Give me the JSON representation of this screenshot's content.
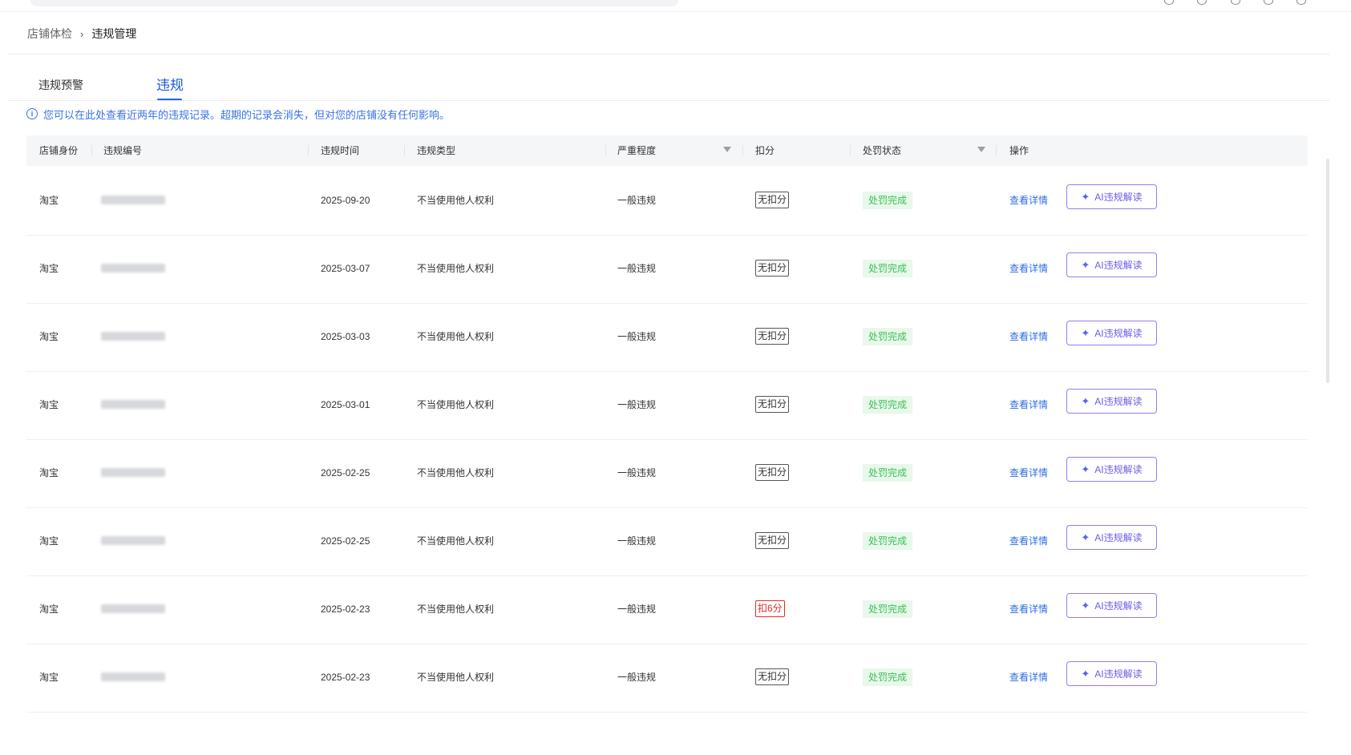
{
  "breadcrumb": {
    "parent": "店铺体检",
    "separator": "›",
    "current": "违规管理"
  },
  "tabs": [
    {
      "label": "违规预警"
    },
    {
      "label": "违规"
    }
  ],
  "notice": {
    "text": "您可以在此处查看近两年的违规记录。超期的记录会消失，但对您的店铺没有任何影响。"
  },
  "table": {
    "headers": {
      "shop_identity": "店铺身份",
      "violation_no": "违规编号",
      "violation_time": "违规时间",
      "violation_type": "违规类型",
      "severity": "严重程度",
      "deduction": "扣分",
      "penalty_status": "处罚状态",
      "actions": "操作"
    },
    "rows": [
      {
        "shop": "淘宝",
        "date": "2025-09-20",
        "type": "不当使用他人权利",
        "severity": "一般违规",
        "deduction": "无扣分",
        "deduction_alert": false,
        "status": "处罚完成",
        "detail": "查看详情",
        "ai": "AI违规解读"
      },
      {
        "shop": "淘宝",
        "date": "2025-03-07",
        "type": "不当使用他人权利",
        "severity": "一般违规",
        "deduction": "无扣分",
        "deduction_alert": false,
        "status": "处罚完成",
        "detail": "查看详情",
        "ai": "AI违规解读"
      },
      {
        "shop": "淘宝",
        "date": "2025-03-03",
        "type": "不当使用他人权利",
        "severity": "一般违规",
        "deduction": "无扣分",
        "deduction_alert": false,
        "status": "处罚完成",
        "detail": "查看详情",
        "ai": "AI违规解读"
      },
      {
        "shop": "淘宝",
        "date": "2025-03-01",
        "type": "不当使用他人权利",
        "severity": "一般违规",
        "deduction": "无扣分",
        "deduction_alert": false,
        "status": "处罚完成",
        "detail": "查看详情",
        "ai": "AI违规解读"
      },
      {
        "shop": "淘宝",
        "date": "2025-02-25",
        "type": "不当使用他人权利",
        "severity": "一般违规",
        "deduction": "无扣分",
        "deduction_alert": false,
        "status": "处罚完成",
        "detail": "查看详情",
        "ai": "AI违规解读"
      },
      {
        "shop": "淘宝",
        "date": "2025-02-25",
        "type": "不当使用他人权利",
        "severity": "一般违规",
        "deduction": "无扣分",
        "deduction_alert": false,
        "status": "处罚完成",
        "detail": "查看详情",
        "ai": "AI违规解读"
      },
      {
        "shop": "淘宝",
        "date": "2025-02-23",
        "type": "不当使用他人权利",
        "severity": "一般违规",
        "deduction": "扣6分",
        "deduction_alert": true,
        "status": "处罚完成",
        "detail": "查看详情",
        "ai": "AI违规解读"
      },
      {
        "shop": "淘宝",
        "date": "2025-02-23",
        "type": "不当使用他人权利",
        "severity": "一般违规",
        "deduction": "无扣分",
        "deduction_alert": false,
        "status": "处罚完成",
        "detail": "查看详情",
        "ai": "AI违规解读"
      }
    ]
  },
  "colors": {
    "accent": "#1a66ff",
    "link": "#2d6ee0",
    "status_green": "#3bbf57",
    "deduction_red": "#e02b2b",
    "ai_purple": "#6d5ce6"
  }
}
